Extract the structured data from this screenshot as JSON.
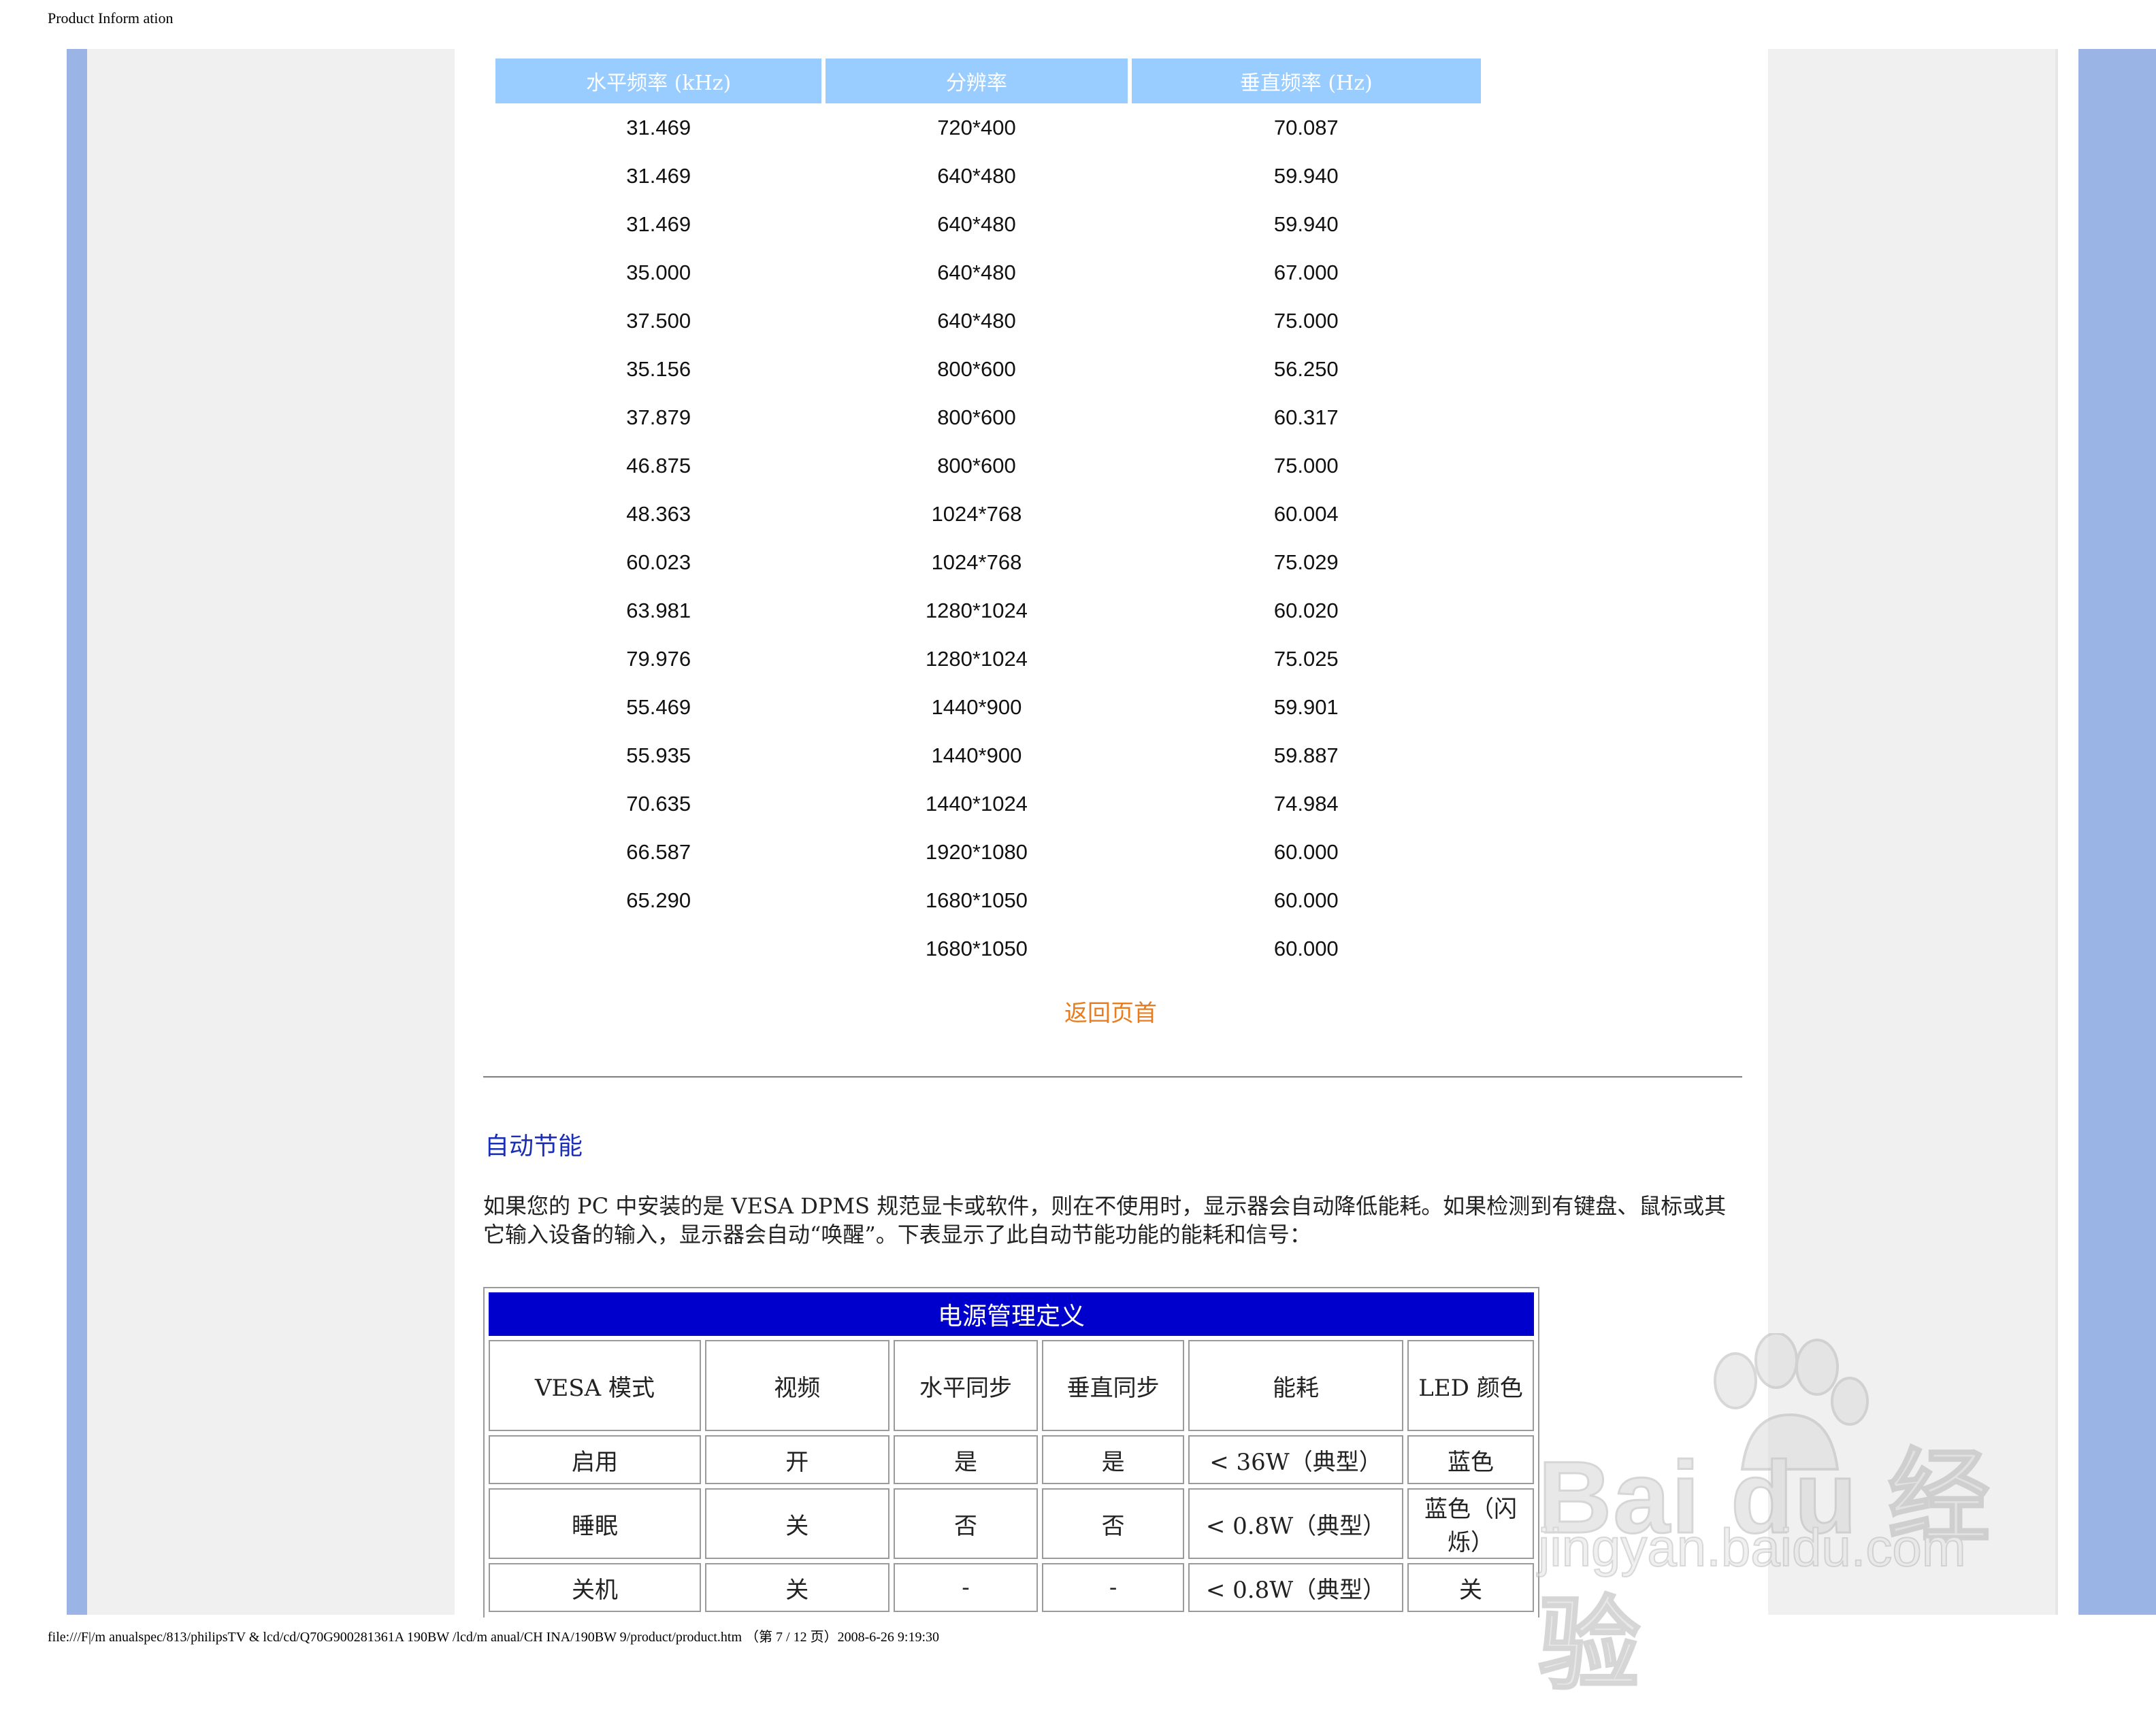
{
  "header": {
    "title": "Product Inform ation"
  },
  "footer": {
    "path": "file:///F|/m anualspec/813/philipsTV & lcd/cd/Q70G900281361A 190BW /lcd/m anual/CH INA/190BW 9/product/product.htm （第 7 / 12 页）2008-6-26 9:19:30"
  },
  "timing": {
    "headers": [
      "水平频率 (kHz)",
      "分辨率",
      "垂直频率 (Hz)"
    ],
    "rows": [
      [
        "31.469",
        "720*400",
        "70.087"
      ],
      [
        "31.469",
        "640*480",
        "59.940"
      ],
      [
        "31.469",
        "640*480",
        "59.940"
      ],
      [
        "35.000",
        "640*480",
        "67.000"
      ],
      [
        "37.500",
        "640*480",
        "75.000"
      ],
      [
        "35.156",
        "800*600",
        "56.250"
      ],
      [
        "37.879",
        "800*600",
        "60.317"
      ],
      [
        "46.875",
        "800*600",
        "75.000"
      ],
      [
        "48.363",
        "1024*768",
        "60.004"
      ],
      [
        "60.023",
        "1024*768",
        "75.029"
      ],
      [
        "63.981",
        "1280*1024",
        "60.020"
      ],
      [
        "79.976",
        "1280*1024",
        "75.025"
      ],
      [
        "55.469",
        "1440*900",
        "59.901"
      ],
      [
        "55.935",
        "1440*900",
        "59.887"
      ],
      [
        "70.635",
        "1440*1024",
        "74.984"
      ],
      [
        "66.587",
        "1920*1080",
        "60.000"
      ],
      [
        "65.290",
        "1680*1050",
        "60.000"
      ],
      [
        "",
        "1680*1050",
        "60.000"
      ]
    ]
  },
  "back_to_top": "返回页首",
  "power": {
    "section_title": "自动节能",
    "description": "如果您的 PC 中安装的是 VESA DPMS 规范显卡或软件，则在不使用时，显示器会自动降低能耗。如果检测到有键盘、鼠标或其它输入设备的输入，显示器会自动“唤醒”。下表显示了此自动节能功能的能耗和信号：",
    "table_title": "电源管理定义",
    "headers": [
      "VESA 模式",
      "视频",
      "水平同步",
      "垂直同步",
      "能耗",
      "LED 颜色"
    ],
    "rows": [
      [
        "启用",
        "开",
        "是",
        "是",
        "< 36W（典型）",
        "蓝色"
      ],
      [
        "睡眠",
        "关",
        "否",
        "否",
        "< 0.8W（典型）",
        "蓝色（闪烁）"
      ],
      [
        "关机",
        "关",
        "-",
        "-",
        "< 0.8W（典型）",
        "关"
      ]
    ]
  },
  "watermark": {
    "brand": "Bai du 经验",
    "url": "jingyan.baidu.com"
  }
}
